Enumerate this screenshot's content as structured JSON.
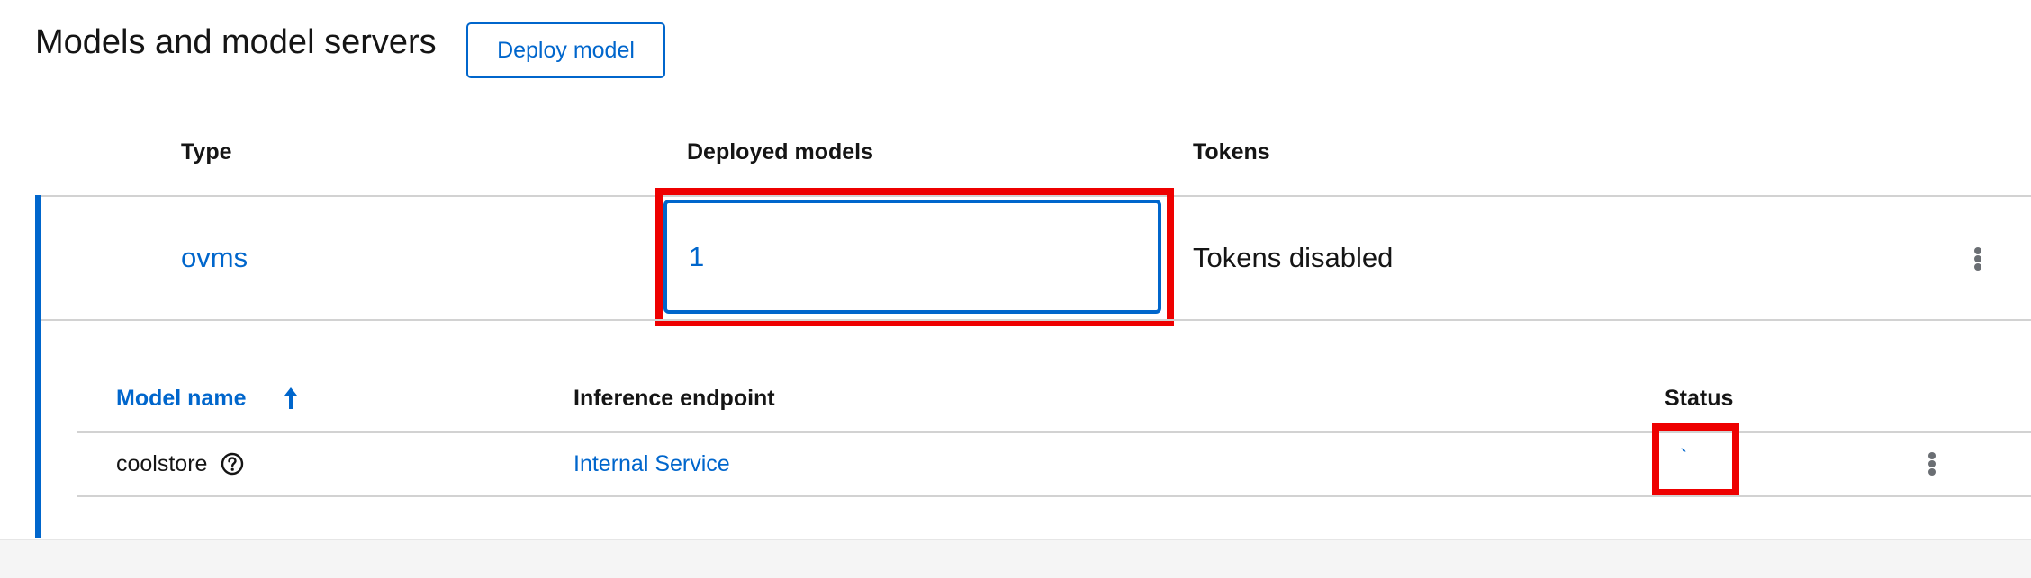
{
  "page": {
    "title": "Models and model servers",
    "deploy_button": "Deploy model"
  },
  "servers_table": {
    "columns": [
      "Type",
      "Deployed models",
      "Tokens"
    ],
    "rows": [
      {
        "type": "ovms",
        "deployed_models": "1",
        "tokens": "Tokens disabled"
      }
    ]
  },
  "models_table": {
    "columns": [
      "Model name",
      "Inference endpoint",
      "Status"
    ],
    "sort": {
      "column": "Model name",
      "direction": "ascending"
    },
    "rows": [
      {
        "name": "coolstore",
        "endpoint": "Internal Service",
        "status": "`"
      }
    ]
  },
  "icons": {
    "sort": "sort-ascending-icon",
    "help": "help-icon",
    "row_actions": "kebab-icon"
  },
  "colors": {
    "accent": "#0066cc",
    "highlight": "#ee0000",
    "text": "#151515",
    "border": "#d2d2d2"
  }
}
